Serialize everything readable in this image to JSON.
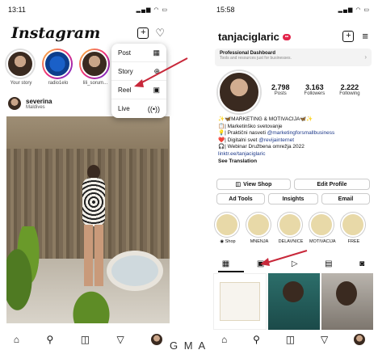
{
  "colors": {
    "accent_red": "#d0243a",
    "story_gradient": [
      "#f9ce34",
      "#ee2a7b",
      "#6228d7"
    ],
    "link": "#1e3a8a"
  },
  "left": {
    "status_time": "13:11",
    "app_logo": "Instagram",
    "top_icons": [
      "plus-square-icon",
      "heart-icon"
    ],
    "stories": [
      {
        "label": "Your story"
      },
      {
        "label": "radio1elo"
      },
      {
        "label": "lili_sorum..."
      }
    ],
    "post": {
      "user": "severina",
      "location": "Maldives"
    },
    "create_menu": [
      {
        "label": "Post",
        "icon": "grid-icon"
      },
      {
        "label": "Story",
        "icon": "story-icon"
      },
      {
        "label": "Reel",
        "icon": "reel-icon"
      },
      {
        "label": "Live",
        "icon": "live-icon"
      }
    ],
    "nav": [
      "home-icon",
      "search-icon",
      "shop-icon",
      "send-icon",
      "profile-icon"
    ]
  },
  "right": {
    "status_time": "15:58",
    "username": "tanjaciglaric",
    "dashboard": {
      "title": "Professional Dashboard",
      "subtitle": "Tools and resources just for businesses."
    },
    "stats": [
      {
        "num": "2.798",
        "label": "Posts"
      },
      {
        "num": "3.163",
        "label": "Followers"
      },
      {
        "num": "2.222",
        "label": "Following"
      }
    ],
    "bio": {
      "line1": "✨🦋MARKETING & MOTIVACIJA🦋✨",
      "line2": "📋| Marketinško svetovanje",
      "line3a": "💡| Praktični nasveti ",
      "line3b": "@marketingforsmallbusiness",
      "line4a": "❤️| Digitalni svet ",
      "line4b": "@revijainternet",
      "line5": "🎧| Webinar Družbena omrežja 2022",
      "link": "linktr.ee/tanjaciglaric",
      "translation": "See Translation"
    },
    "buttons": {
      "view_shop": "View Shop",
      "edit_profile": "Edit Profile",
      "ad_tools": "Ad Tools",
      "insights": "Insights",
      "email": "Email"
    },
    "highlights": [
      {
        "label": "Shop"
      },
      {
        "label": "MNENJA"
      },
      {
        "label": "DELAVNICE"
      },
      {
        "label": "MOTIVACIJA"
      },
      {
        "label": "FREE"
      }
    ],
    "tabs": [
      "grid-tab-icon",
      "reels-tab-icon",
      "video-tab-icon",
      "guides-tab-icon",
      "tagged-tab-icon"
    ],
    "nav": [
      "home-icon",
      "search-icon",
      "shop-icon",
      "send-icon",
      "profile-icon"
    ]
  },
  "watermark": "G M A"
}
